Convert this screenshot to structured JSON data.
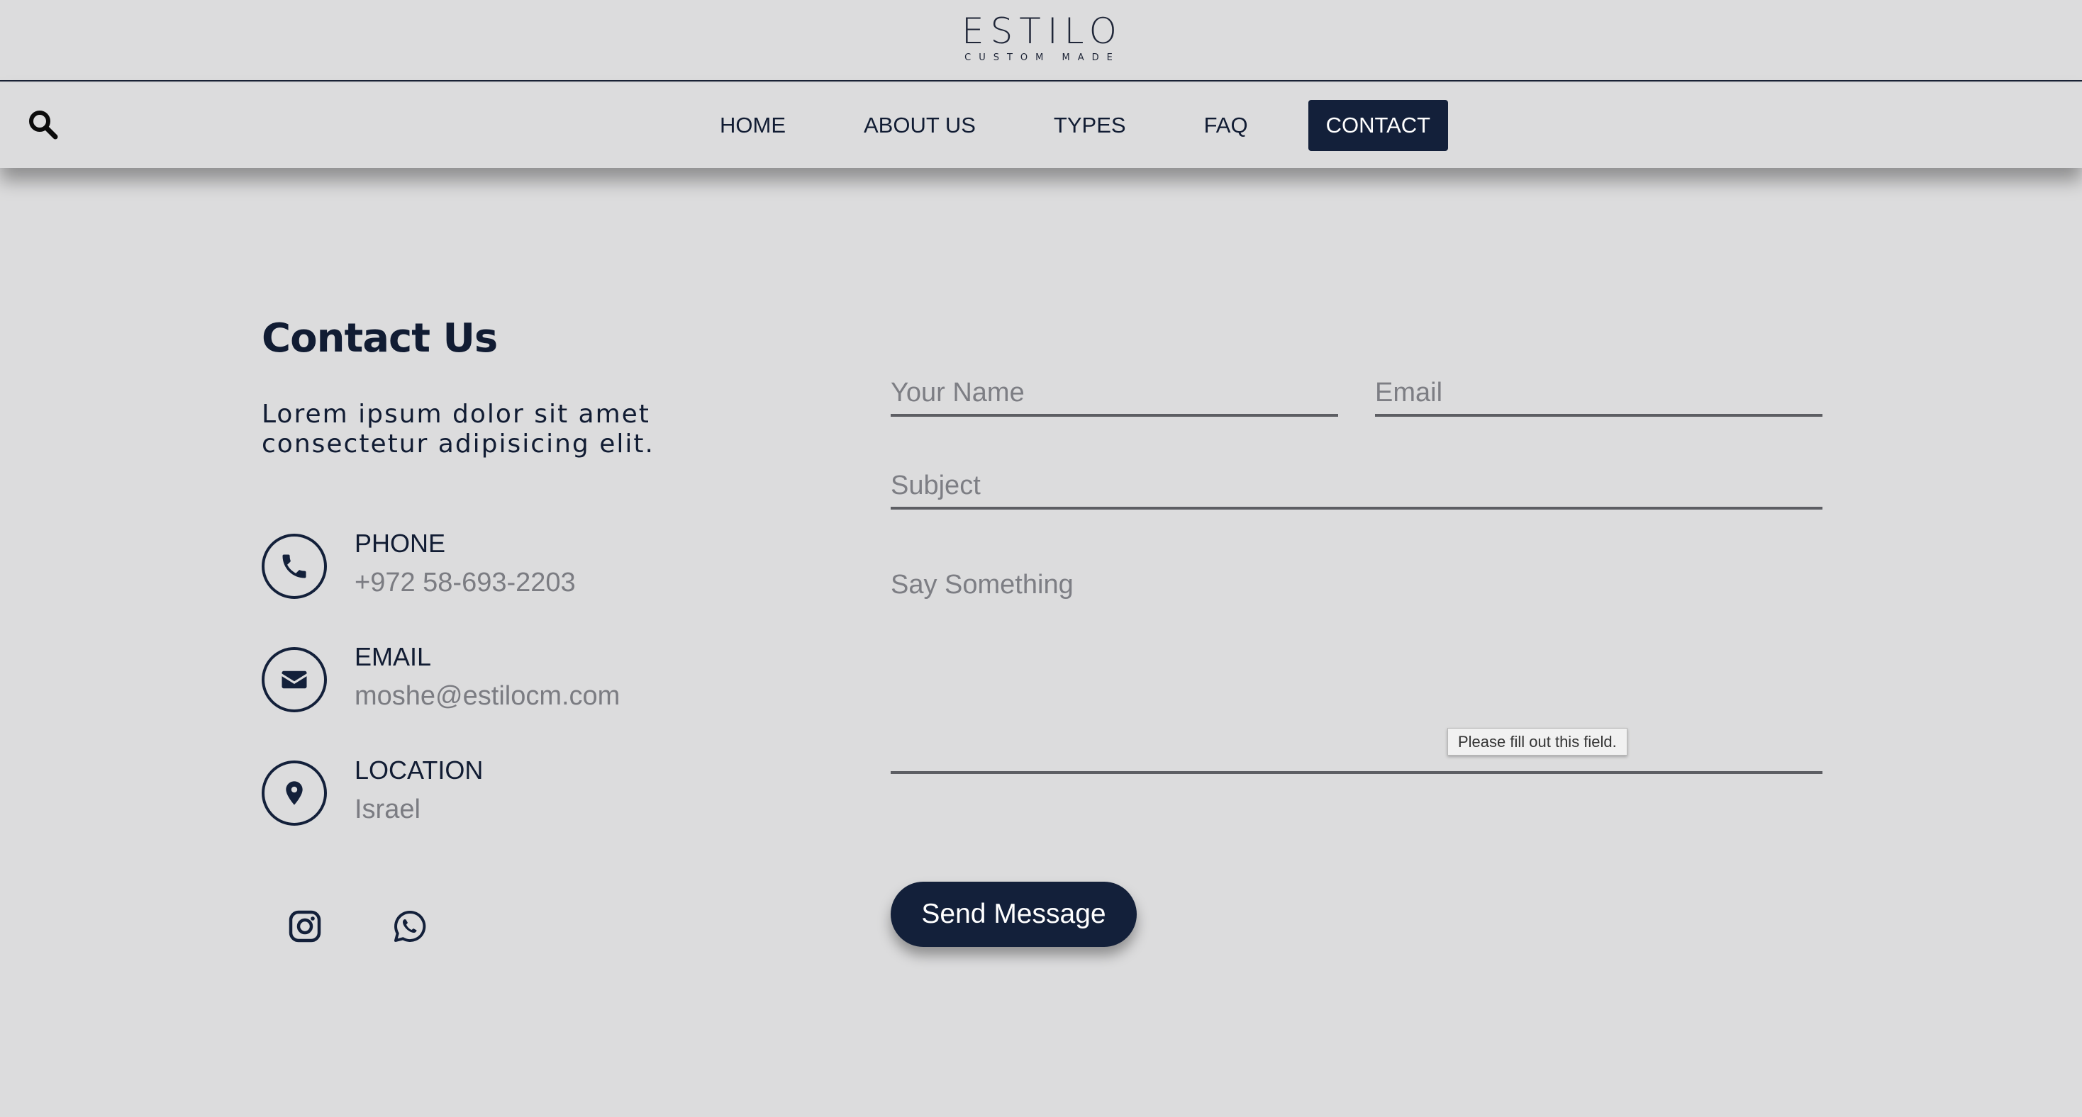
{
  "brand": {
    "name": "ESTILO",
    "tagline": "CUSTOM MADE"
  },
  "nav": {
    "search_icon": "search-icon",
    "links": [
      {
        "label": "HOME",
        "active": false
      },
      {
        "label": "ABOUT US",
        "active": false
      },
      {
        "label": "TYPES",
        "active": false
      },
      {
        "label": "FAQ",
        "active": false
      },
      {
        "label": "CONTACT",
        "active": true
      }
    ]
  },
  "contact": {
    "title": "Contact Us",
    "description": "Lorem ipsum dolor sit amet consectetur adipisicing elit.",
    "items": [
      {
        "icon": "phone-icon",
        "label": "PHONE",
        "value": "+972 58-693-2203"
      },
      {
        "icon": "envelope-icon",
        "label": "EMAIL",
        "value": "moshe@estilocm.com"
      },
      {
        "icon": "map-pin-icon",
        "label": "LOCATION",
        "value": "Israel"
      }
    ],
    "social": [
      "instagram-icon",
      "whatsapp-icon"
    ]
  },
  "form": {
    "name_placeholder": "Your Name",
    "name_value": "",
    "email_placeholder": "Email",
    "email_value": "",
    "subject_placeholder": "Subject",
    "subject_value": "",
    "message_placeholder": "Say Something",
    "message_value": "",
    "validation_tooltip": "Please fill out this field.",
    "submit_label": "Send Message"
  },
  "colors": {
    "background": "#dcdcdd",
    "primary_navy": "#13203a",
    "muted_text": "#7b7c82"
  }
}
